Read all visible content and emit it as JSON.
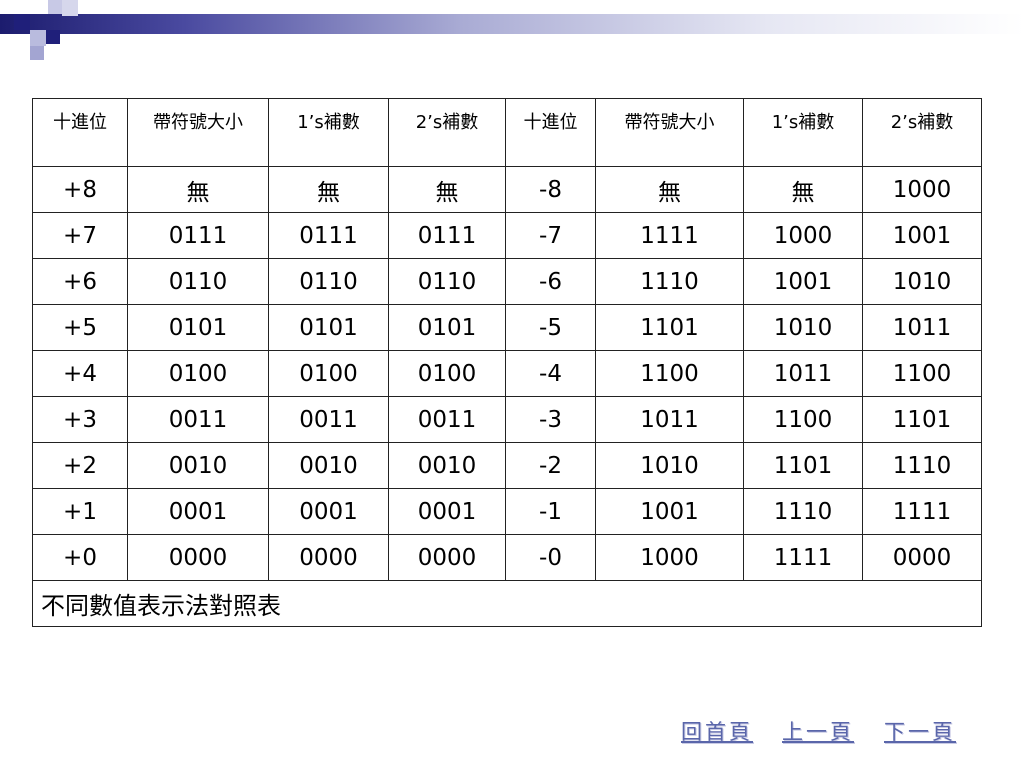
{
  "table": {
    "headers": [
      "十進位",
      "帶符號大小",
      "1’s補數",
      "2’s補數",
      "十進位",
      "帶符號大小",
      "1’s補數",
      "2’s補數"
    ],
    "rows": [
      [
        "+8",
        "無",
        "無",
        "無",
        "-8",
        "無",
        "無",
        "1000"
      ],
      [
        "+7",
        "0111",
        "0111",
        "0111",
        "-7",
        "1111",
        "1000",
        "1001"
      ],
      [
        "+6",
        "0110",
        "0110",
        "0110",
        "-6",
        "1110",
        "1001",
        "1010"
      ],
      [
        "+5",
        "0101",
        "0101",
        "0101",
        "-5",
        "1101",
        "1010",
        "1011"
      ],
      [
        "+4",
        "0100",
        "0100",
        "0100",
        "-4",
        "1100",
        "1011",
        "1100"
      ],
      [
        "+3",
        "0011",
        "0011",
        "0011",
        "-3",
        "1011",
        "1100",
        "1101"
      ],
      [
        "+2",
        "0010",
        "0010",
        "0010",
        "-2",
        "1010",
        "1101",
        "1110"
      ],
      [
        "+1",
        "0001",
        "0001",
        "0001",
        "-1",
        "1001",
        "1110",
        "1111"
      ],
      [
        "+0",
        "0000",
        "0000",
        "0000",
        "-0",
        "1000",
        "1111",
        "0000"
      ]
    ],
    "caption": "不同數值表示法對照表"
  },
  "nav": {
    "home": "回首頁",
    "prev": "上一頁",
    "next": "下一頁"
  },
  "colors": {
    "header_dark": "#1f1f7a",
    "header_light": "#c8c9e6",
    "nav_link": "#5a66aa"
  }
}
